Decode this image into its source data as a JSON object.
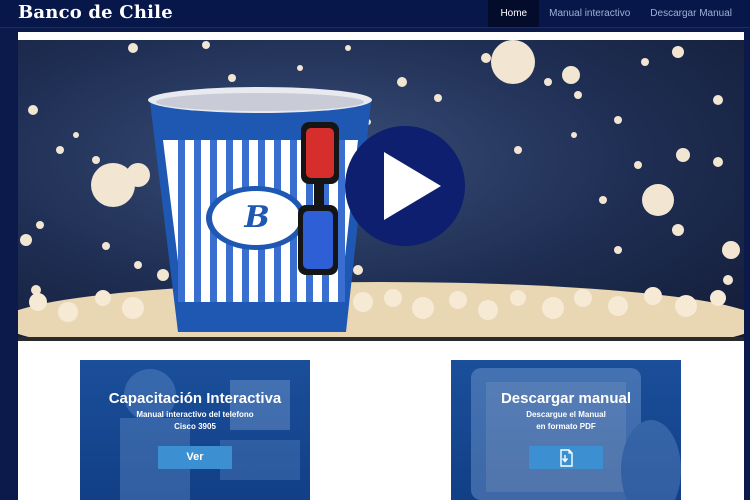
{
  "brand": "Banco de Chile",
  "nav": {
    "items": [
      {
        "label": "Home",
        "active": true
      },
      {
        "label": "Manual interactivo",
        "active": false
      },
      {
        "label": "Descargar Manual",
        "active": false
      }
    ]
  },
  "hero": {
    "cup_logo_letter": "B",
    "play_icon": "play-icon"
  },
  "cards": {
    "interactive": {
      "title": "Capacitación Interactiva",
      "subtitle_line1": "Manual interactivo del telefono",
      "subtitle_line2": "Cisco 3905",
      "button_label": "Ver"
    },
    "download": {
      "title": "Descargar manual",
      "subtitle_line1": "Descargue el Manual",
      "subtitle_line2": "en formato PDF",
      "button_icon": "download-document-icon"
    }
  },
  "colors": {
    "navbar": "#08174a",
    "card": "#1b4f9a",
    "button": "#3c8fd1",
    "play_circle": "#0d1f6e"
  }
}
